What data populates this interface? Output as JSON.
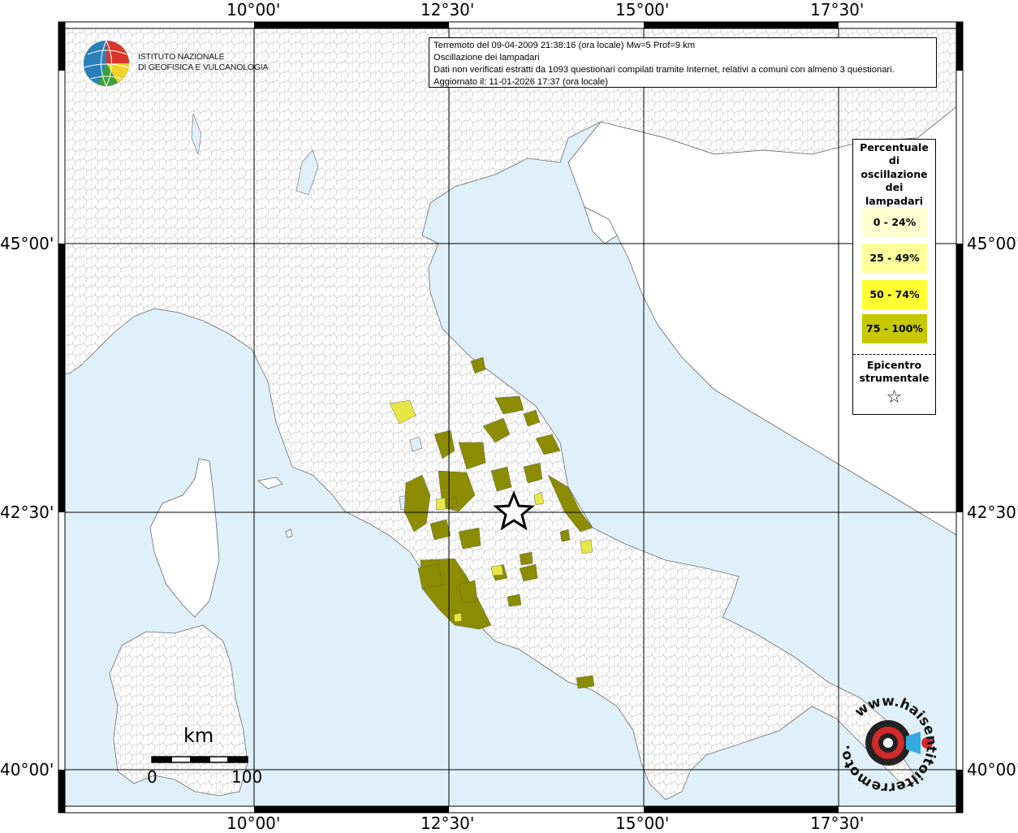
{
  "map_title_box": {
    "line1": "Terremoto del 09-04-2009 21:38:16 (ora locale) Mw=5 Prof=9 km",
    "line2": "Oscillazione dei lampadari",
    "line3": "Dati non verificati estratti da 1093 questionari compilati tramite Internet, relativi a comuni con almeno 3 questionari.",
    "line4": "Aggiornato il: 11-01-2026 17:37 (ora locale)"
  },
  "logo": {
    "line1": "ISTITUTO NAZIONALE",
    "line2": "DI GEOFISICA E VULCANOLOGIA"
  },
  "axes": {
    "lon_ticks": [
      "10°00'",
      "12°30'",
      "15°00'",
      "17°30'"
    ],
    "lat_ticks": [
      "45°00'",
      "42°30'",
      "40°00'"
    ]
  },
  "legend": {
    "title_lines": [
      "Percentuale",
      "di",
      "oscillazione",
      "dei",
      "lampadari"
    ],
    "classes": [
      {
        "label": "0 - 24%",
        "color": "#ffffd0"
      },
      {
        "label": "25 - 49%",
        "color": "#ffff9a"
      },
      {
        "label": "50 - 74%",
        "color": "#ffff33"
      },
      {
        "label": "75 - 100%",
        "color": "#c8c800"
      }
    ],
    "epicentre_lines": [
      "Epicentro",
      "strumentale"
    ],
    "epicentre_symbol": "☆"
  },
  "scale_bar": {
    "unit": "km",
    "start": "0",
    "end": "100"
  },
  "haisentito_logo": {
    "text": "www.haisentitoilterremoto.it",
    "icon": "seismometer-icon"
  },
  "colors": {
    "sea": "#e0f0fb",
    "land": "#ffffff",
    "class_75_100_map": "#8c8c00",
    "class_50_74_map": "#e6e645"
  }
}
